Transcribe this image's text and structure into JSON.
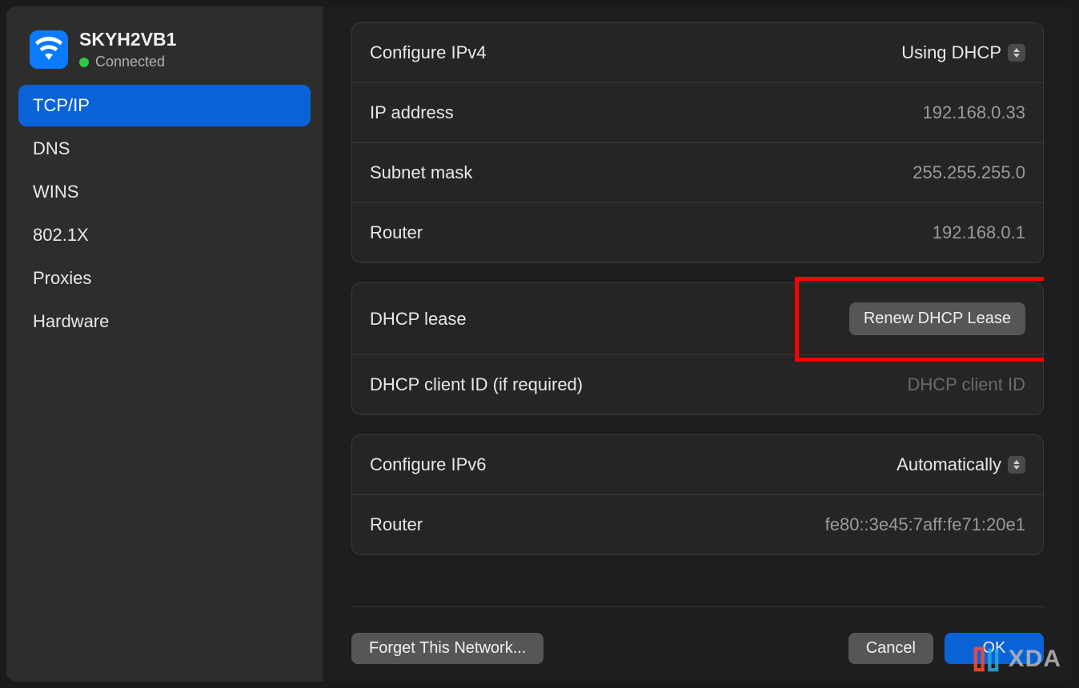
{
  "network": {
    "name": "SKYH2VB1",
    "status": "Connected"
  },
  "sidebar": {
    "items": [
      {
        "label": "TCP/IP",
        "active": true
      },
      {
        "label": "DNS",
        "active": false
      },
      {
        "label": "WINS",
        "active": false
      },
      {
        "label": "802.1X",
        "active": false
      },
      {
        "label": "Proxies",
        "active": false
      },
      {
        "label": "Hardware",
        "active": false
      }
    ]
  },
  "groups": {
    "ipv4": {
      "configure_label": "Configure IPv4",
      "configure_value": "Using DHCP",
      "ip_label": "IP address",
      "ip_value": "192.168.0.33",
      "subnet_label": "Subnet mask",
      "subnet_value": "255.255.255.0",
      "router_label": "Router",
      "router_value": "192.168.0.1"
    },
    "dhcp": {
      "lease_label": "DHCP lease",
      "renew_button": "Renew DHCP Lease",
      "client_id_label": "DHCP client ID (if required)",
      "client_id_placeholder": "DHCP client ID"
    },
    "ipv6": {
      "configure_label": "Configure IPv6",
      "configure_value": "Automatically",
      "router_label": "Router",
      "router_value": "fe80::3e45:7aff:fe71:20e1"
    }
  },
  "footer": {
    "forget_label": "Forget This Network...",
    "cancel_label": "Cancel",
    "ok_label": "OK"
  },
  "watermark": "XDA"
}
